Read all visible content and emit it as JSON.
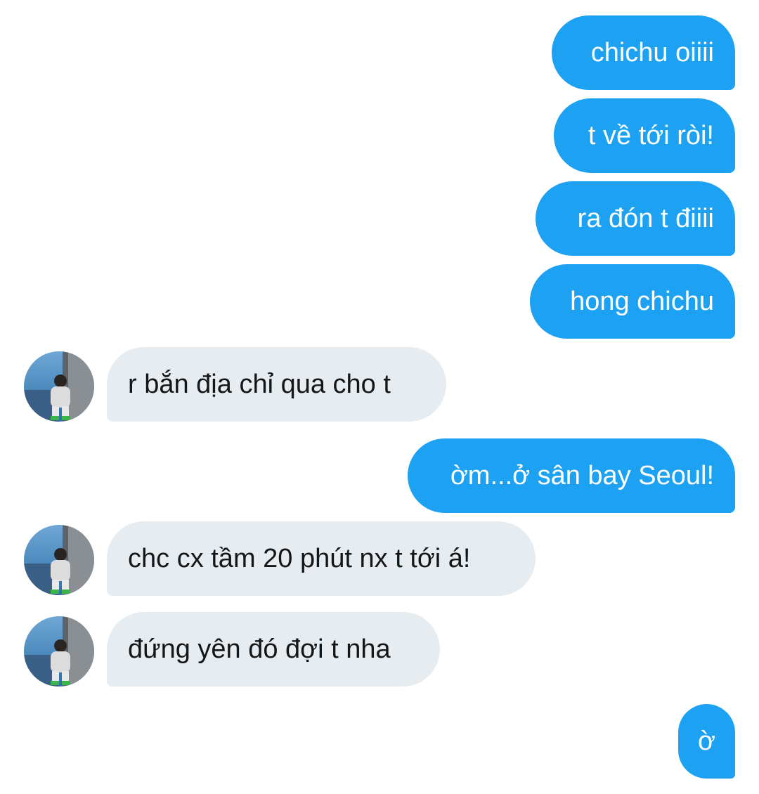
{
  "conversation": {
    "messages": [
      {
        "direction": "outgoing",
        "text": "chichu oiiii"
      },
      {
        "direction": "outgoing",
        "text": "t về tới ròi!"
      },
      {
        "direction": "outgoing",
        "text": "ra đón t điiii"
      },
      {
        "direction": "outgoing",
        "text": "hong chichu"
      },
      {
        "direction": "incoming",
        "text": "r bắn địa chỉ qua cho t",
        "avatar": "contact-avatar"
      },
      {
        "direction": "outgoing",
        "text": "ờm...ở sân bay Seoul!"
      },
      {
        "direction": "incoming",
        "text": "chc cx tầm 20 phút nx t tới á!",
        "avatar": "contact-avatar"
      },
      {
        "direction": "incoming",
        "text": "đứng yên đó đợi t nha",
        "avatar": "contact-avatar"
      },
      {
        "direction": "outgoing",
        "text": "ờ"
      }
    ]
  },
  "colors": {
    "outgoing_bubble": "#1da1f2",
    "incoming_bubble": "#e6ecf0",
    "outgoing_text": "#ffffff",
    "incoming_text": "#14171a"
  }
}
